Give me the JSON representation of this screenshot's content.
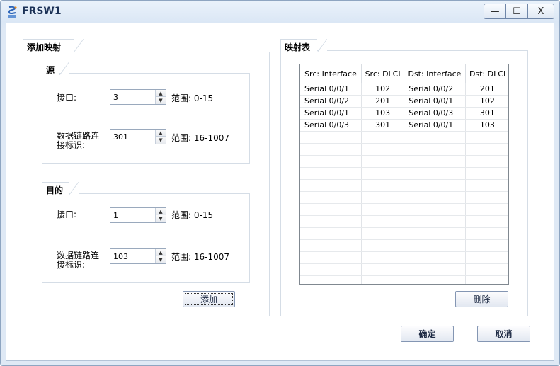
{
  "window": {
    "title": "FRSW1",
    "min": "—",
    "max": "☐",
    "close": "X"
  },
  "add_group": {
    "title": "添加映射",
    "source": {
      "title": "源",
      "interface_label": "接口:",
      "interface_value": "3",
      "interface_range": "范围: 0-15",
      "dlci_label_1": "数据链路连",
      "dlci_label_2": "接标识:",
      "dlci_value": "301",
      "dlci_range": "范围: 16-1007"
    },
    "dest": {
      "title": "目的",
      "interface_label": "接口:",
      "interface_value": "1",
      "interface_range": "范围: 0-15",
      "dlci_label_1": "数据链路连",
      "dlci_label_2": "接标识:",
      "dlci_value": "103",
      "dlci_range": "范围: 16-1007"
    },
    "add_button": "添加"
  },
  "map_group": {
    "title": "映射表",
    "columns": [
      "Src: Interface",
      "Src: DLCI",
      "Dst: Interface",
      "Dst: DLCI"
    ],
    "rows": [
      [
        "Serial 0/0/1",
        "102",
        "Serial 0/0/2",
        "201"
      ],
      [
        "Serial 0/0/2",
        "201",
        "Serial 0/0/1",
        "102"
      ],
      [
        "Serial 0/0/1",
        "103",
        "Serial 0/0/3",
        "301"
      ],
      [
        "Serial 0/0/3",
        "301",
        "Serial 0/0/1",
        "103"
      ]
    ],
    "delete_button": "删除"
  },
  "footer": {
    "ok": "确定",
    "cancel": "取消"
  }
}
